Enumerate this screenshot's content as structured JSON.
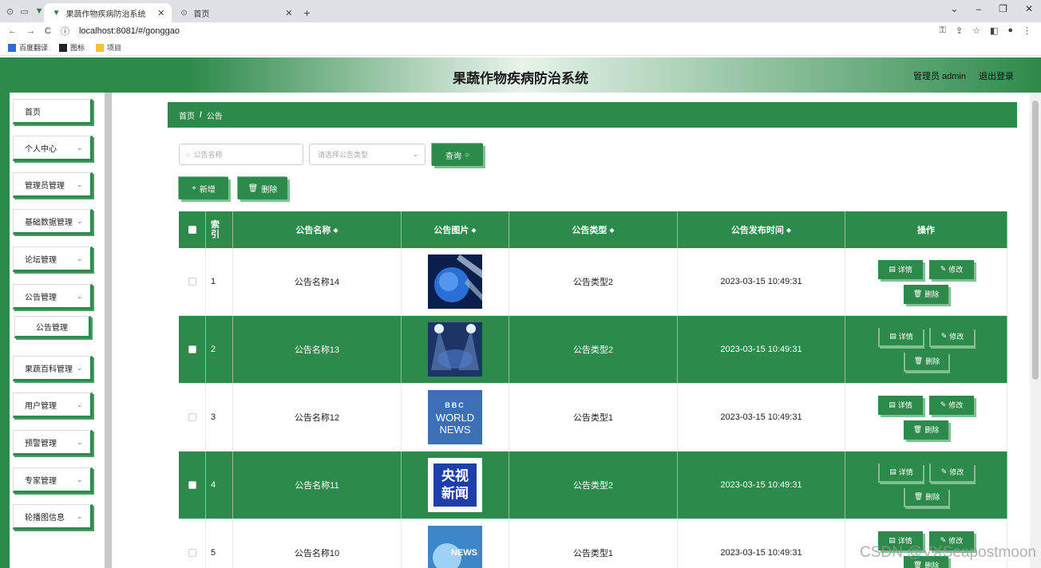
{
  "browser": {
    "tabs": [
      {
        "title": "果蔬作物疾病防治系统",
        "active": true
      },
      {
        "title": "首页",
        "active": false
      }
    ],
    "url": "localhost:8081/#/gonggao",
    "bookmarks": [
      "百度翻译",
      "图标",
      "项目"
    ]
  },
  "header": {
    "title": "果蔬作物疾病防治系统",
    "user": "管理员 admin",
    "logout": "退出登录"
  },
  "sidebar": {
    "items": [
      {
        "label": "首页",
        "has_children": false
      },
      {
        "label": "个人中心",
        "has_children": true
      },
      {
        "label": "管理员管理",
        "has_children": true
      },
      {
        "label": "基础数据管理",
        "has_children": true
      },
      {
        "label": "论坛管理",
        "has_children": true
      },
      {
        "label": "公告管理",
        "has_children": true
      },
      {
        "label": "公告管理",
        "sub": true
      },
      {
        "label": "果蔬百科管理",
        "has_children": true
      },
      {
        "label": "用户管理",
        "has_children": true
      },
      {
        "label": "预警管理",
        "has_children": true
      },
      {
        "label": "专家管理",
        "has_children": true
      },
      {
        "label": "轮播图信息",
        "has_children": true
      }
    ]
  },
  "breadcrumb": {
    "home": "首页",
    "sep": "/",
    "current": "公告"
  },
  "search": {
    "name_placeholder": "公告名称",
    "type_placeholder": "请选择公告类型",
    "query_label": "查询"
  },
  "actions": {
    "add_label": "新增",
    "delete_label": "删除"
  },
  "table": {
    "headers": {
      "index": "索引",
      "name": "公告名称",
      "image": "公告图片",
      "type": "公告类型",
      "time": "公告发布时间",
      "ops": "操作"
    },
    "op_labels": {
      "detail": "详情",
      "edit": "修改",
      "delete": "删除"
    },
    "rows": [
      {
        "index": "1",
        "name": "公告名称14",
        "type": "公告类型2",
        "time": "2023-03-15 10:49:31",
        "image": "globe"
      },
      {
        "index": "2",
        "name": "公告名称13",
        "type": "公告类型2",
        "time": "2023-03-15 10:49:31",
        "image": "stage"
      },
      {
        "index": "3",
        "name": "公告名称12",
        "type": "公告类型1",
        "time": "2023-03-15 10:49:31",
        "image": "bbc",
        "image_text": [
          "BBC",
          "WORLD",
          "NEWS"
        ]
      },
      {
        "index": "4",
        "name": "公告名称11",
        "type": "公告类型2",
        "time": "2023-03-15 10:49:31",
        "image": "cctv",
        "image_text": [
          "央视",
          "新闻"
        ]
      },
      {
        "index": "5",
        "name": "公告名称10",
        "type": "公告类型1",
        "time": "2023-03-15 10:49:31",
        "image": "news",
        "image_text": [
          "NEWS"
        ]
      }
    ]
  },
  "watermark": "CSDN @VXSeapostmoon",
  "colors": {
    "primary": "#2c8a4a",
    "accent": "#7fbf92"
  }
}
